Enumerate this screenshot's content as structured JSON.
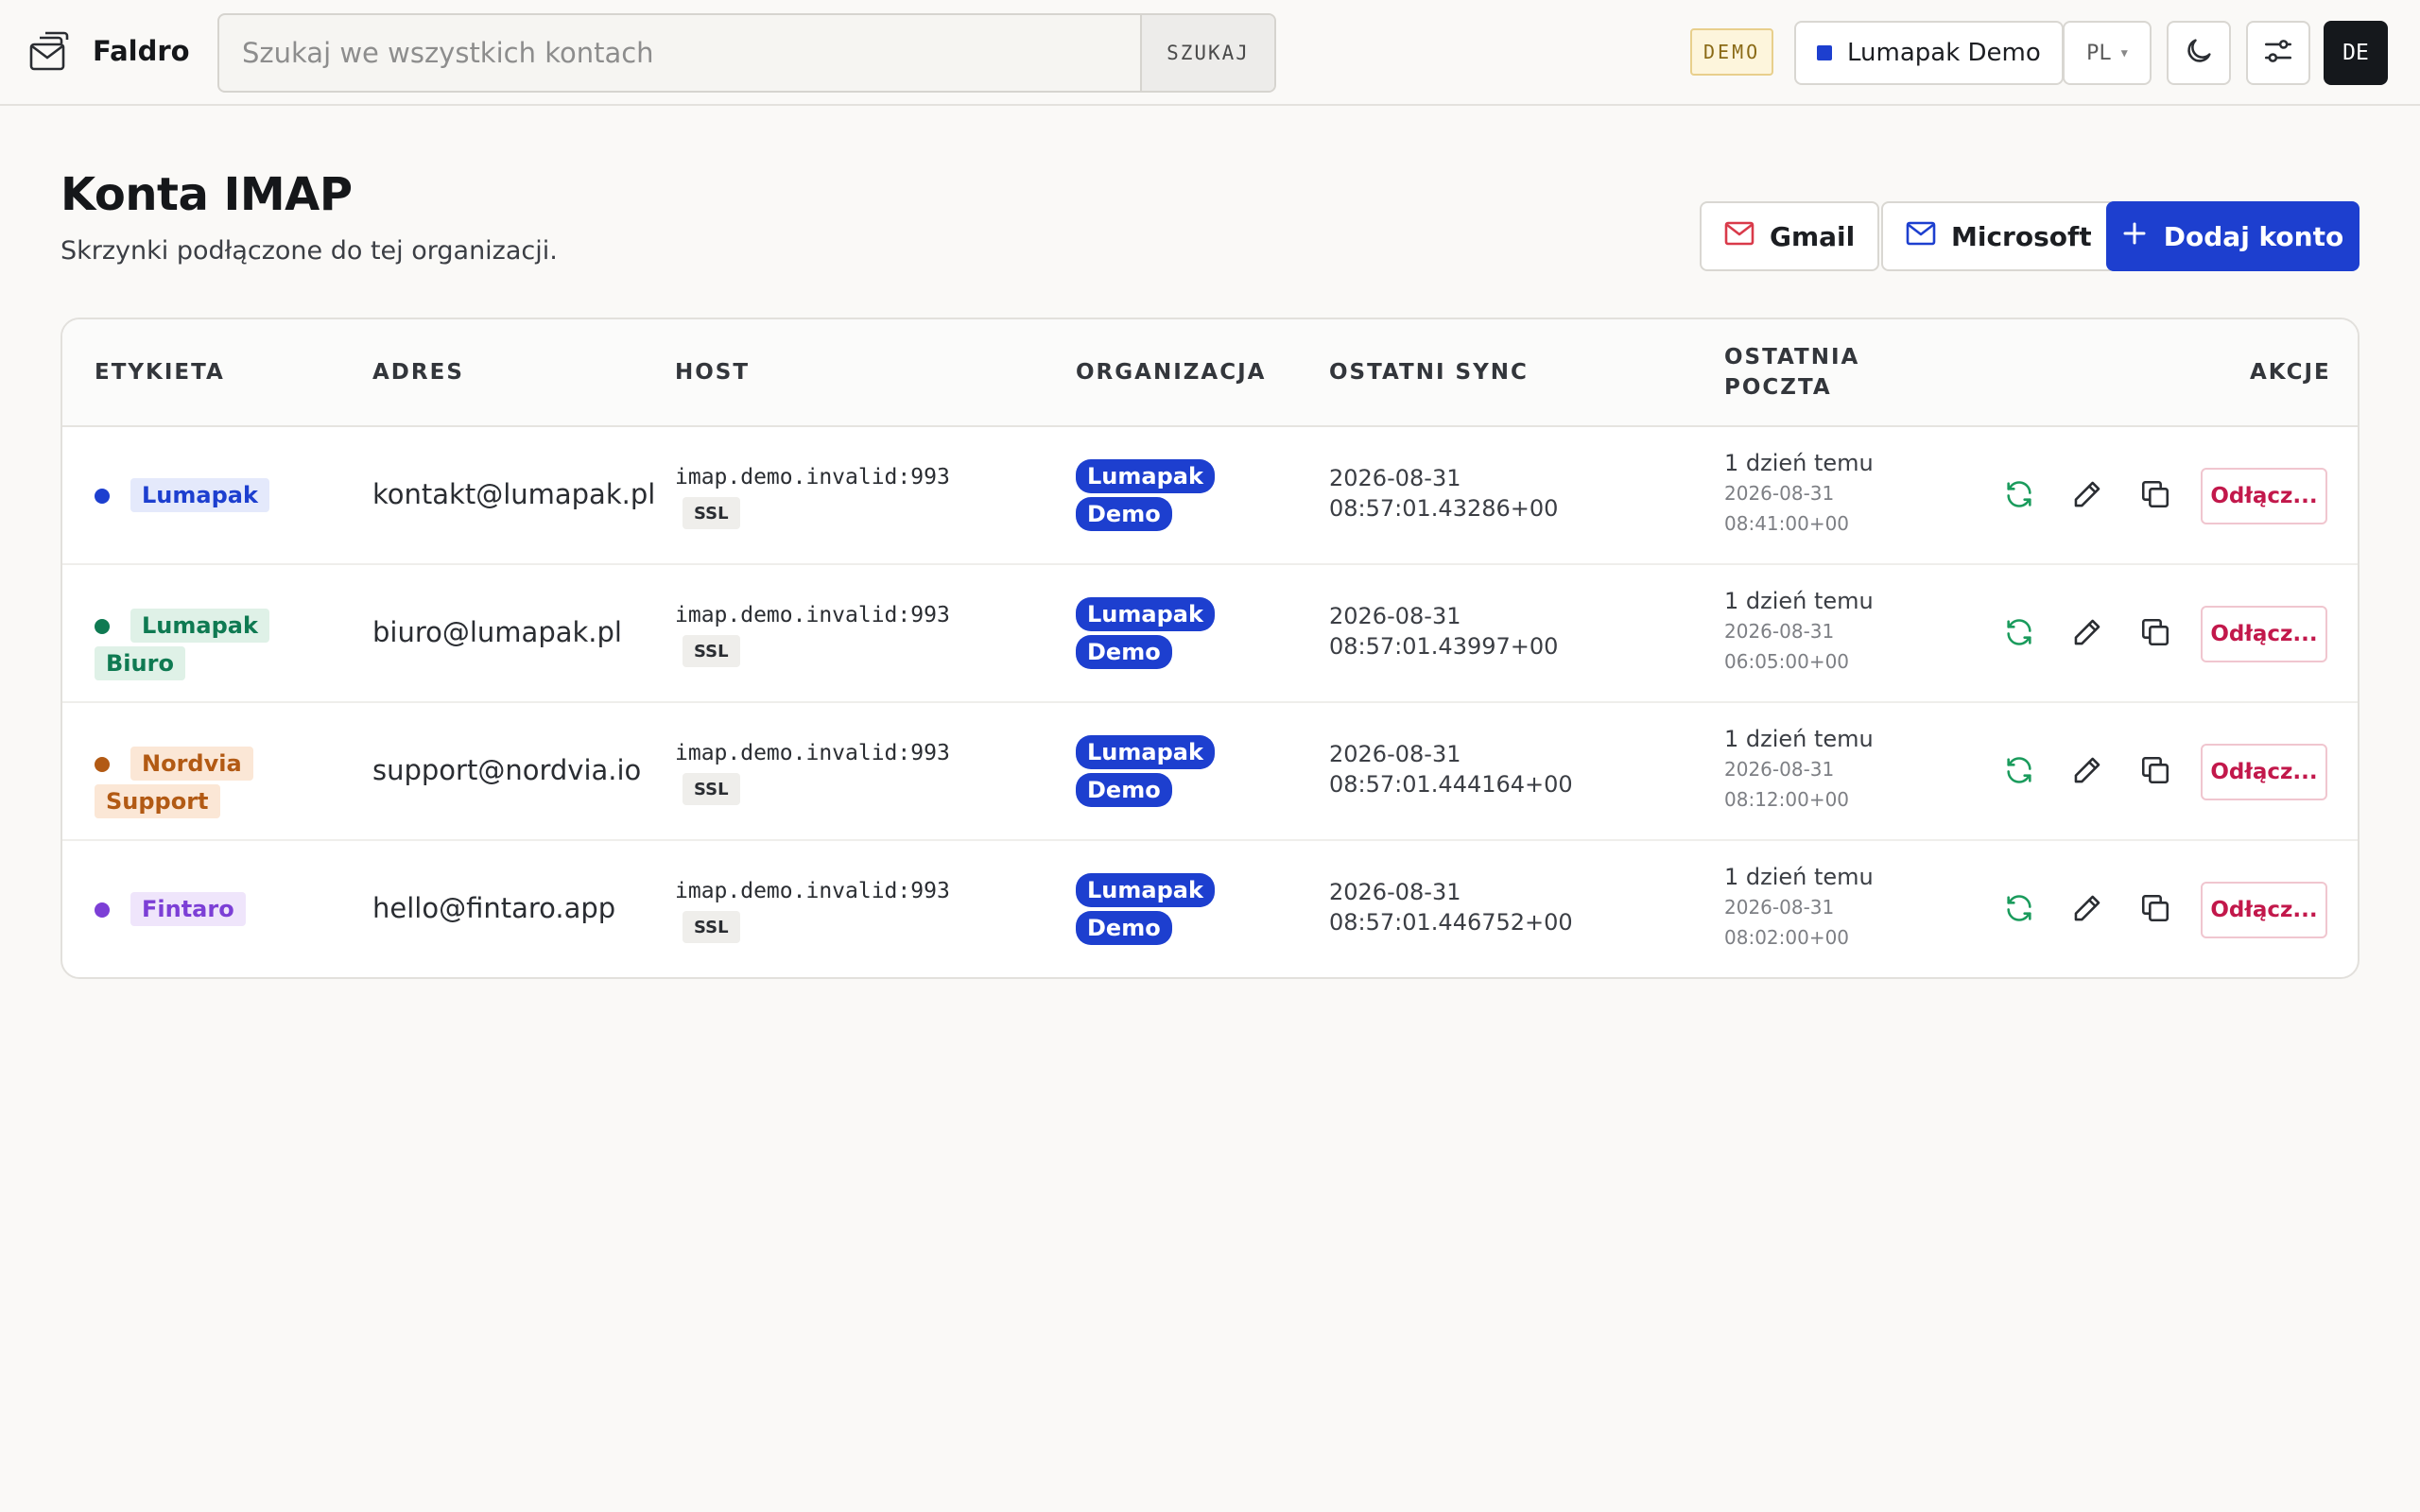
{
  "brand": {
    "name": "Faldro",
    "icon": "envelope-stack-icon"
  },
  "search": {
    "placeholder": "Szukaj we wszystkich kontach",
    "value": "",
    "button_label": "SZUKAJ"
  },
  "topbar": {
    "demo_badge": "DEMO",
    "org_switcher": {
      "label": "Lumapak Demo",
      "color": "#1d3fcf"
    },
    "language": "PL",
    "theme_icon": "moon-icon",
    "settings_icon": "sliders-icon",
    "avatar": "DE"
  },
  "page": {
    "title": "Konta IMAP",
    "subtitle": "Skrzynki podłączone do tej organizacji."
  },
  "header_actions": {
    "gmail_label": "Gmail",
    "microsoft_label": "Microsoft",
    "add_label": "Dodaj konto"
  },
  "table": {
    "columns": {
      "label": "ETYKIETA",
      "address": "ADRES",
      "host": "HOST",
      "organization": "ORGANIZACJA",
      "last_sync": "OSTATNI SYNC",
      "last_mail_1": "OSTATNIA",
      "last_mail_2": "POCZTA",
      "actions": "AKCJE"
    },
    "rows": [
      {
        "label": "Lumapak",
        "label_color": "#1d3fcf",
        "label_bg": "#e4e9fb",
        "address": "kontakt@lumapak.pl",
        "host": "imap.demo.invalid:993",
        "ssl": "SSL",
        "org_1": "Lumapak",
        "org_2": "Demo",
        "sync_1": "2026-08-31",
        "sync_2": "08:57:01.43286+00",
        "mail_rel": "1 dzień temu",
        "mail_date": "2026-08-31",
        "mail_time": "08:41:00+00",
        "detach": "Odłącz..."
      },
      {
        "label_1": "Lumapak",
        "label_2": "Biuro",
        "label_color": "#0f7a52",
        "label_bg": "#dff1e7",
        "address": "biuro@lumapak.pl",
        "host": "imap.demo.invalid:993",
        "ssl": "SSL",
        "org_1": "Lumapak",
        "org_2": "Demo",
        "sync_1": "2026-08-31",
        "sync_2": "08:57:01.43997+00",
        "mail_rel": "1 dzień temu",
        "mail_date": "2026-08-31",
        "mail_time": "06:05:00+00",
        "detach": "Odłącz..."
      },
      {
        "label_1": "Nordvia",
        "label_2": "Support",
        "label_color": "#b25a14",
        "label_bg": "#fbe7d6",
        "address": "support@nordvia.io",
        "host": "imap.demo.invalid:993",
        "ssl": "SSL",
        "org_1": "Lumapak",
        "org_2": "Demo",
        "sync_1": "2026-08-31",
        "sync_2": "08:57:01.444164+00",
        "mail_rel": "1 dzień temu",
        "mail_date": "2026-08-31",
        "mail_time": "08:12:00+00",
        "detach": "Odłącz..."
      },
      {
        "label": "Fintaro",
        "label_color": "#7c3fd6",
        "label_bg": "#efe5fb",
        "address": "hello@fintaro.app",
        "host": "imap.demo.invalid:993",
        "ssl": "SSL",
        "org_1": "Lumapak",
        "org_2": "Demo",
        "sync_1": "2026-08-31",
        "sync_2": "08:57:01.446752+00",
        "mail_rel": "1 dzień temu",
        "mail_date": "2026-08-31",
        "mail_time": "08:02:00+00",
        "detach": "Odłącz..."
      }
    ],
    "row_action_icons": [
      "sync-icon",
      "edit-icon",
      "copy-icon"
    ]
  },
  "colors": {
    "primary": "#1d3fcf",
    "danger": "#c2184b",
    "success": "#1a9b5c",
    "gmail": "#d93a4a"
  }
}
